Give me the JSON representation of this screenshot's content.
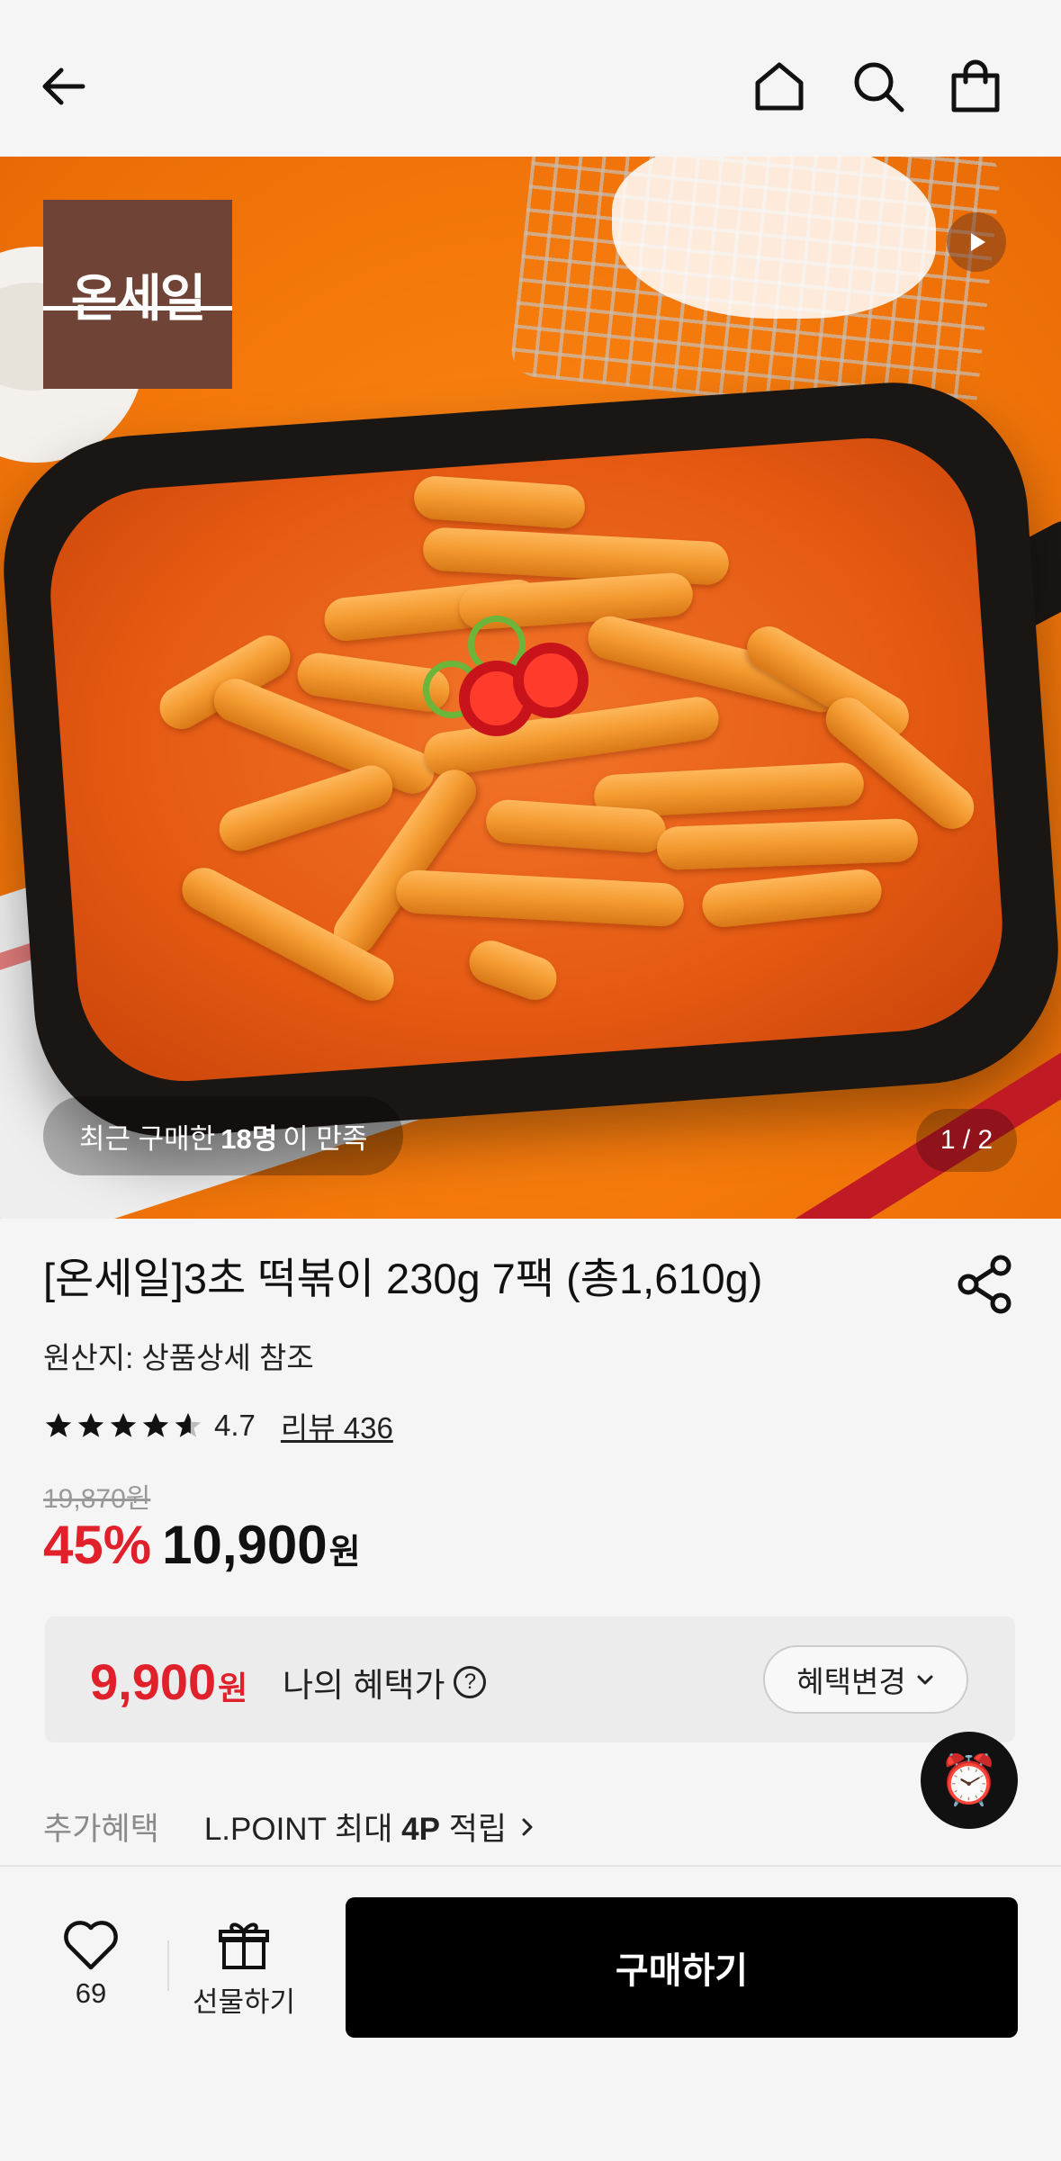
{
  "header": {
    "back_icon": "arrow-left-icon",
    "home_icon": "home-icon",
    "search_icon": "search-icon",
    "cart_icon": "shopping-bag-icon"
  },
  "hero": {
    "brand_logo_text": "온세일",
    "buyers_prefix": "최근 구매한 ",
    "buyers_count": "18명",
    "buyers_suffix": "이 만족",
    "pager": "1 / 2"
  },
  "product": {
    "title": "[온세일]3초 떡볶이 230g 7팩 (총1,610g)",
    "origin": "원산지: 상품상세 참조",
    "rating": "4.7",
    "rating_value": 4.7,
    "review_link": "리뷰 436",
    "original_price": "19,870원",
    "discount": "45%",
    "sale_price": "10,900",
    "price_unit": "원"
  },
  "benefit": {
    "price": "9,900",
    "unit": "원",
    "label": "나의 혜택가",
    "help": "?",
    "change_button": "혜택변경"
  },
  "extra": {
    "label": "추가혜택",
    "text_prefix": "L.POINT 최대 ",
    "text_bold": "4P",
    "text_suffix": " 적립"
  },
  "bottom_bar": {
    "like_count": "69",
    "gift_label": "선물하기",
    "buy_label": "구매하기"
  },
  "colors": {
    "accent_red": "#e0212b",
    "buy_button": "#000000",
    "brand_logo_bg": "#6f4336"
  }
}
